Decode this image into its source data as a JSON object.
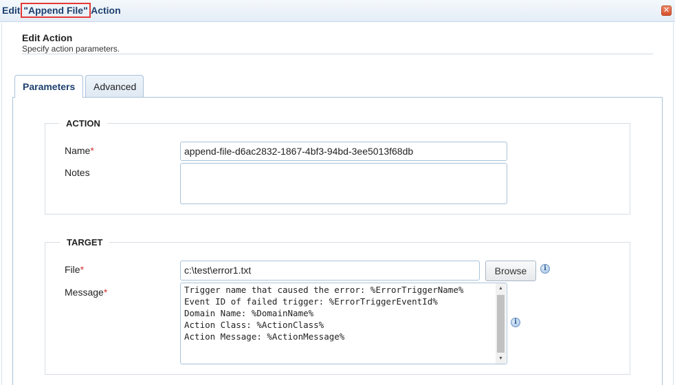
{
  "window": {
    "title_prefix": "Edit ",
    "title_highlight": "\"Append File\"",
    "title_suffix": " Action",
    "close_symbol": "✕"
  },
  "header": {
    "title": "Edit Action",
    "subtitle": "Specify action parameters."
  },
  "tabs": [
    {
      "label": "Parameters",
      "active": true
    },
    {
      "label": "Advanced",
      "active": false
    }
  ],
  "action_group": {
    "legend": "ACTION",
    "name_label": "Name",
    "name_value": "append-file-d6ac2832-1867-4bf3-94bd-3ee5013f68db",
    "notes_label": "Notes",
    "notes_value": ""
  },
  "target_group": {
    "legend": "TARGET",
    "file_label": "File",
    "file_value": "c:\\test\\error1.txt",
    "browse_label": "Browse",
    "message_label": "Message",
    "message_lines": [
      "Trigger name that caused the error: %ErrorTriggerName%",
      "Event ID of failed trigger: %ErrorTriggerEventId%",
      "Domain Name: %DomainName%",
      "Action Class: %ActionClass%",
      "Action Message: %ActionMessage%"
    ]
  },
  "required_marker": "*",
  "icons": {
    "close": "close-icon",
    "info": "info-icon"
  },
  "colors": {
    "title_text": "#1c3f6e",
    "required": "#d32f2f",
    "highlight_outline": "#e53935",
    "input_border": "#a9c2da"
  }
}
